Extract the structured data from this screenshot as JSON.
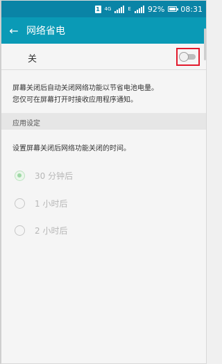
{
  "status_bar": {
    "signal_label": "4G",
    "battery_percent": "92%",
    "time": "08:31"
  },
  "app_bar": {
    "back_icon": "arrow-left-icon",
    "title": "网络省电"
  },
  "master_switch": {
    "label": "关",
    "checked": false
  },
  "description": {
    "line1": "屏幕关闭后自动关闭网络功能以节省电池电量。",
    "line2": "您仅可在屏幕打开时接收应用程序通知。"
  },
  "settings_section": {
    "header": "应用设定",
    "instruction": "设置屏幕关闭后网络功能关闭的时间。",
    "options": [
      {
        "label": "30 分钟后",
        "selected": true,
        "enabled": false
      },
      {
        "label": "1 小时后",
        "selected": false,
        "enabled": false
      },
      {
        "label": "2 小时后",
        "selected": false,
        "enabled": false
      }
    ]
  },
  "colors": {
    "status_bar": "#0a84a6",
    "app_bar": "#0a9ab6",
    "highlight_border": "#e2192c",
    "disabled_radio": "#9fd8a6"
  }
}
